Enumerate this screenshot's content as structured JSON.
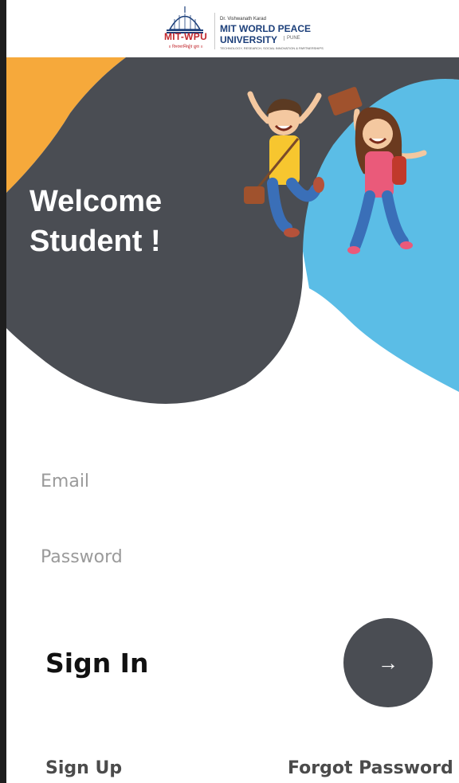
{
  "header": {
    "logo_abbr": "MIT-WPU",
    "logo_tagline": "॥ विश्वशान्तिर्ध्रुवं ध्रुवा ॥",
    "logo_prefix": "Dr. Vishwanath Karad",
    "logo_line1": "MIT WORLD PEACE",
    "logo_line2": "UNIVERSITY",
    "logo_city": "PUNE",
    "logo_subtitle": "TECHNOLOGY, RESEARCH, SOCIAL INNOVATION & PARTNERSHIPS"
  },
  "hero": {
    "welcome_line1": "Welcome",
    "welcome_line2": "Student !",
    "colors": {
      "dark": "#4a4d53",
      "blue": "#5bbde6",
      "orange": "#f6a93b"
    }
  },
  "form": {
    "email_placeholder": "Email",
    "password_placeholder": "Password",
    "signin_label": "Sign In",
    "submit_icon": "arrow-right-icon"
  },
  "footer": {
    "signup_label": "Sign Up",
    "forgot_label": "Forgot Password"
  }
}
